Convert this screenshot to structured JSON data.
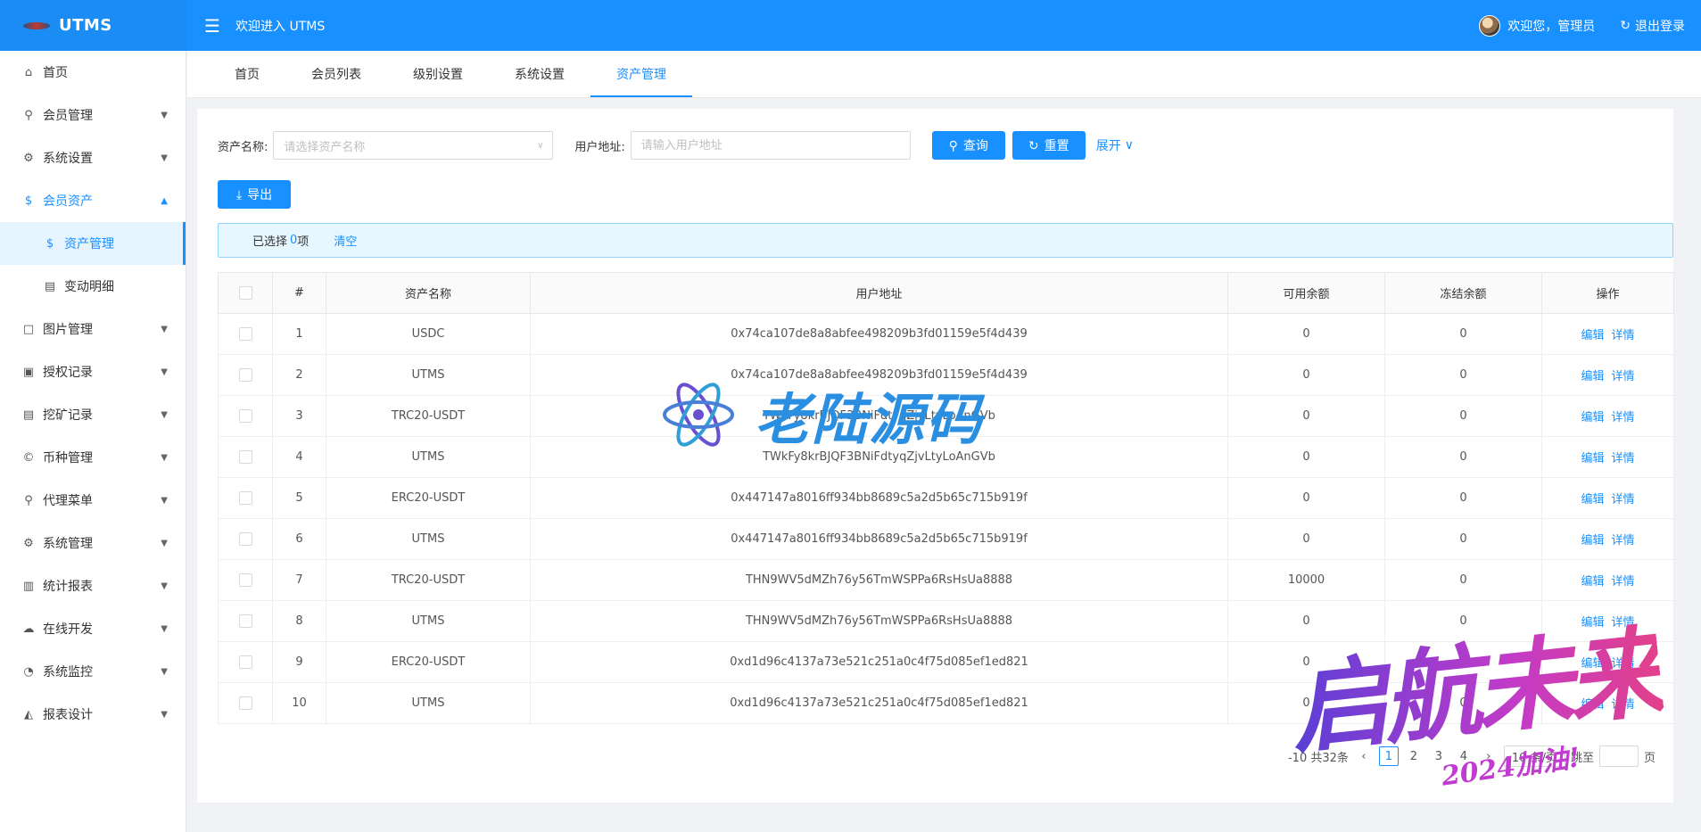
{
  "header": {
    "logo_text": "UTMS",
    "welcome_title": "欢迎进入 UTMS",
    "user_greeting": "欢迎您，管理员",
    "logout_label": "退出登录"
  },
  "sidebar": {
    "items": [
      {
        "label": "首页",
        "icon": "home-icon"
      },
      {
        "label": "会员管理",
        "icon": "user-icon"
      },
      {
        "label": "系统设置",
        "icon": "gear-icon"
      },
      {
        "label": "会员资产",
        "icon": "dollar-icon"
      },
      {
        "label": "资产管理",
        "icon": "dollar-icon"
      },
      {
        "label": "变动明细",
        "icon": "list-icon"
      },
      {
        "label": "图片管理",
        "icon": "square-icon"
      },
      {
        "label": "授权记录",
        "icon": "image-icon"
      },
      {
        "label": "挖矿记录",
        "icon": "list-icon"
      },
      {
        "label": "币种管理",
        "icon": "copyright-icon"
      },
      {
        "label": "代理菜单",
        "icon": "user-icon"
      },
      {
        "label": "系统管理",
        "icon": "gear-icon"
      },
      {
        "label": "统计报表",
        "icon": "bar-chart-icon"
      },
      {
        "label": "在线开发",
        "icon": "cloud-icon"
      },
      {
        "label": "系统监控",
        "icon": "dashboard-icon"
      },
      {
        "label": "报表设计",
        "icon": "area-chart-icon"
      }
    ]
  },
  "tabs": [
    {
      "label": "首页"
    },
    {
      "label": "会员列表"
    },
    {
      "label": "级别设置"
    },
    {
      "label": "系统设置"
    },
    {
      "label": "资产管理"
    }
  ],
  "filter": {
    "asset_label": "资产名称:",
    "asset_placeholder": "请选择资产名称",
    "address_label": "用户地址:",
    "address_placeholder": "请输入用户地址",
    "query_label": "查询",
    "reset_label": "重置",
    "expand_label": "展开"
  },
  "export_label": "导出",
  "selection": {
    "prefix": "已选择",
    "count": "0",
    "suffix": "项",
    "clear_label": "清空"
  },
  "table": {
    "columns": [
      "#",
      "资产名称",
      "用户地址",
      "可用余额",
      "冻结余额",
      "操作"
    ],
    "edit_label": "编辑",
    "detail_label": "详情",
    "rows": [
      {
        "no": "1",
        "asset": "USDC",
        "address": "0x74ca107de8a8abfee498209b3fd01159e5f4d439",
        "available": "0",
        "frozen": "0"
      },
      {
        "no": "2",
        "asset": "UTMS",
        "address": "0x74ca107de8a8abfee498209b3fd01159e5f4d439",
        "available": "0",
        "frozen": "0"
      },
      {
        "no": "3",
        "asset": "TRC20-USDT",
        "address": "TWkFy8krBJQF3BNiFdtyqZjvLtyLoAnGVb",
        "available": "0",
        "frozen": "0"
      },
      {
        "no": "4",
        "asset": "UTMS",
        "address": "TWkFy8krBJQF3BNiFdtyqZjvLtyLoAnGVb",
        "available": "0",
        "frozen": "0"
      },
      {
        "no": "5",
        "asset": "ERC20-USDT",
        "address": "0x447147a8016ff934bb8689c5a2d5b65c715b919f",
        "available": "0",
        "frozen": "0"
      },
      {
        "no": "6",
        "asset": "UTMS",
        "address": "0x447147a8016ff934bb8689c5a2d5b65c715b919f",
        "available": "0",
        "frozen": "0"
      },
      {
        "no": "7",
        "asset": "TRC20-USDT",
        "address": "THN9WV5dMZh76y56TmWSPPa6RsHsUa8888",
        "available": "10000",
        "frozen": "0"
      },
      {
        "no": "8",
        "asset": "UTMS",
        "address": "THN9WV5dMZh76y56TmWSPPa6RsHsUa8888",
        "available": "0",
        "frozen": "0"
      },
      {
        "no": "9",
        "asset": "ERC20-USDT",
        "address": "0xd1d96c4137a73e521c251a0c4f75d085ef1ed821",
        "available": "0",
        "frozen": "0"
      },
      {
        "no": "10",
        "asset": "UTMS",
        "address": "0xd1d96c4137a73e521c251a0c4f75d085ef1ed821",
        "available": "0",
        "frozen": "0"
      }
    ]
  },
  "pagination": {
    "total_text": "-10 共32条",
    "pages": [
      "1",
      "2",
      "3",
      "4"
    ],
    "page_size": "10 条/页",
    "jump_prefix": "跳至",
    "jump_suffix": "页"
  },
  "watermarks": {
    "center_text": "老陆源码",
    "corner_text": "启航未来",
    "corner_sub": "2024加油!"
  }
}
